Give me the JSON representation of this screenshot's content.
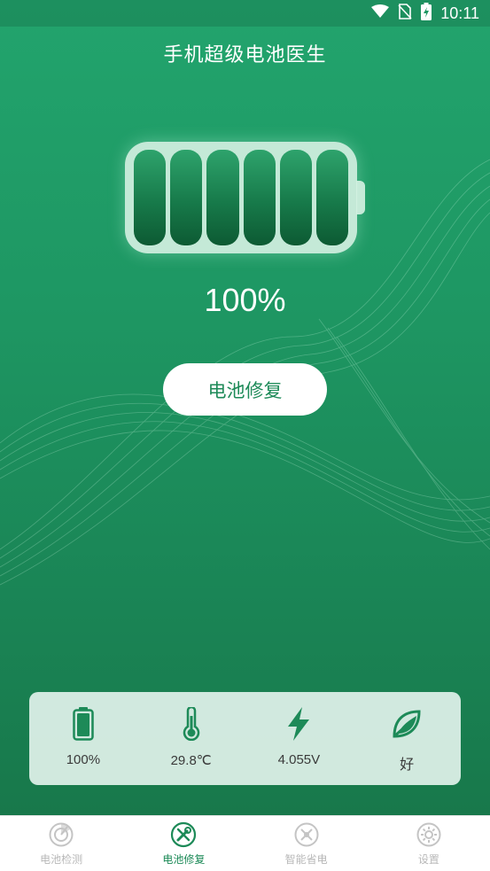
{
  "status_bar": {
    "time": "10:11",
    "icons": [
      "wifi-icon",
      "no-sim-icon",
      "battery-charging-icon"
    ]
  },
  "header": {
    "title": "手机超级电池医生"
  },
  "battery": {
    "level_percent": 100,
    "cells_filled": 6,
    "cells_total": 6,
    "percent_text": "100%"
  },
  "actions": {
    "repair_label": "电池修复"
  },
  "info": {
    "items": [
      {
        "icon": "battery-level-icon",
        "value": "100%"
      },
      {
        "icon": "thermometer-icon",
        "value": "29.8℃"
      },
      {
        "icon": "lightning-icon",
        "value": "4.055V"
      },
      {
        "icon": "leaf-health-icon",
        "value": "好"
      }
    ]
  },
  "nav": {
    "active_index": 1,
    "items": [
      {
        "label": "电池检测",
        "icon": "radar-icon"
      },
      {
        "label": "电池修复",
        "icon": "repair-tools-icon"
      },
      {
        "label": "智能省电",
        "icon": "power-save-icon"
      },
      {
        "label": "设置",
        "icon": "settings-gear-icon"
      }
    ]
  },
  "colors": {
    "accent": "#1d8a58",
    "background_top": "#22a46d",
    "background_bottom": "#177548",
    "inactive_nav": "#b8b8b8"
  }
}
